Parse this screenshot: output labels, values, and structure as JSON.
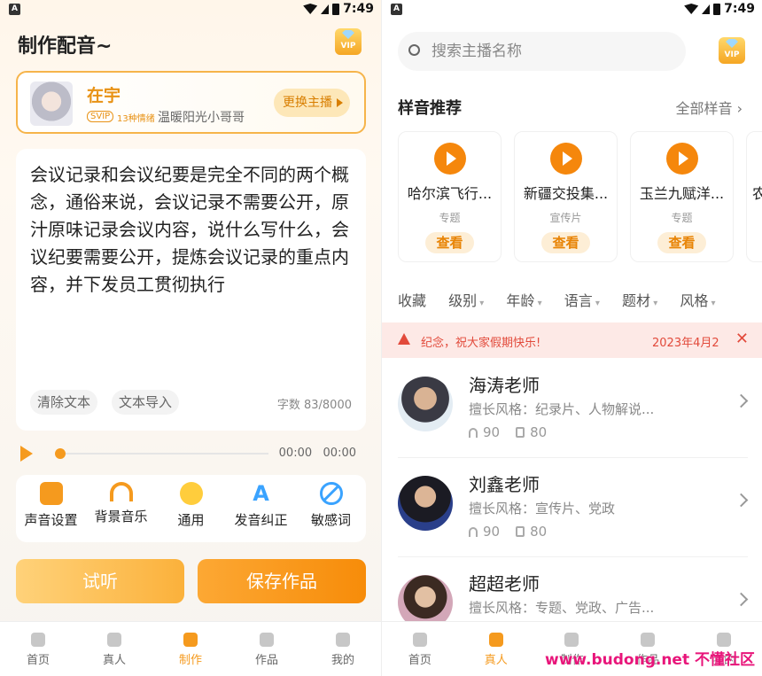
{
  "status": {
    "time": "7:49"
  },
  "left": {
    "title": "制作配音~",
    "vip": "VIP",
    "anchor": {
      "name": "在宇",
      "svip": "SVIP",
      "emotions": "13种情绪",
      "desc": "温暖阳光小哥哥",
      "change_btn": "更换主播"
    },
    "text": "会议记录和会议纪要是完全不同的两个概念，通俗来说，会议记录不需要公开，原汁原味记录会议内容，说什么写什么，会议纪要需要公开，提炼会议记录的重点内容，并下发员工贯彻执行",
    "clear_btn": "清除文本",
    "import_btn": "文本导入",
    "word_count": "字数 83/8000",
    "player": {
      "current": "00:00",
      "total": "00:00",
      "progress": 0
    },
    "tools": [
      {
        "label": "声音设置",
        "icon": "sliders-icon"
      },
      {
        "label": "背景音乐",
        "icon": "headphones-icon"
      },
      {
        "label": "通用",
        "icon": "smile-icon"
      },
      {
        "label": "发音纠正",
        "icon": "letter-a-icon"
      },
      {
        "label": "敏感词",
        "icon": "ban-icon"
      }
    ],
    "listen_btn": "试听",
    "save_btn": "保存作品"
  },
  "tabs": [
    {
      "label": "首页",
      "icon": "home-icon"
    },
    {
      "label": "真人",
      "icon": "person-icon"
    },
    {
      "label": "制作",
      "icon": "waveform-icon"
    },
    {
      "label": "作品",
      "icon": "works-icon"
    },
    {
      "label": "我的",
      "icon": "profile-icon"
    }
  ],
  "left_active_tab": 2,
  "right_active_tab": 1,
  "right": {
    "search_placeholder": "搜索主播名称",
    "vip": "VIP",
    "sample_title": "样音推荐",
    "sample_more": "全部样音",
    "samples": [
      {
        "name": "哈尔滨飞行...",
        "tag": "专题",
        "btn": "查看"
      },
      {
        "name": "新疆交投集...",
        "tag": "宣传片",
        "btn": "查看"
      },
      {
        "name": "玉兰九赋洋...",
        "tag": "专题",
        "btn": "查看"
      },
      {
        "name": "农",
        "tag": "",
        "btn": ""
      }
    ],
    "filters": [
      "收藏",
      "级别",
      "年龄",
      "语言",
      "题材",
      "风格"
    ],
    "notice": {
      "text": "纪念，祝大家假期快乐!",
      "date": "2023年4月2",
      "close": "✕"
    },
    "anchors": [
      {
        "name": "海涛老师",
        "style": "擅长风格：纪录片、人物解说...",
        "listens": "90",
        "works": "80"
      },
      {
        "name": "刘鑫老师",
        "style": "擅长风格：宣传片、党政",
        "listens": "90",
        "works": "80"
      },
      {
        "name": "超超老师",
        "style": "擅长风格：专题、党政、广告...",
        "listens": "",
        "works": ""
      }
    ]
  },
  "watermark": "www.budong.net 不懂社区",
  "colors": {
    "accent": "#f59a1e",
    "notice_bg": "#fde9e6",
    "notice_text": "#e24a3b"
  }
}
